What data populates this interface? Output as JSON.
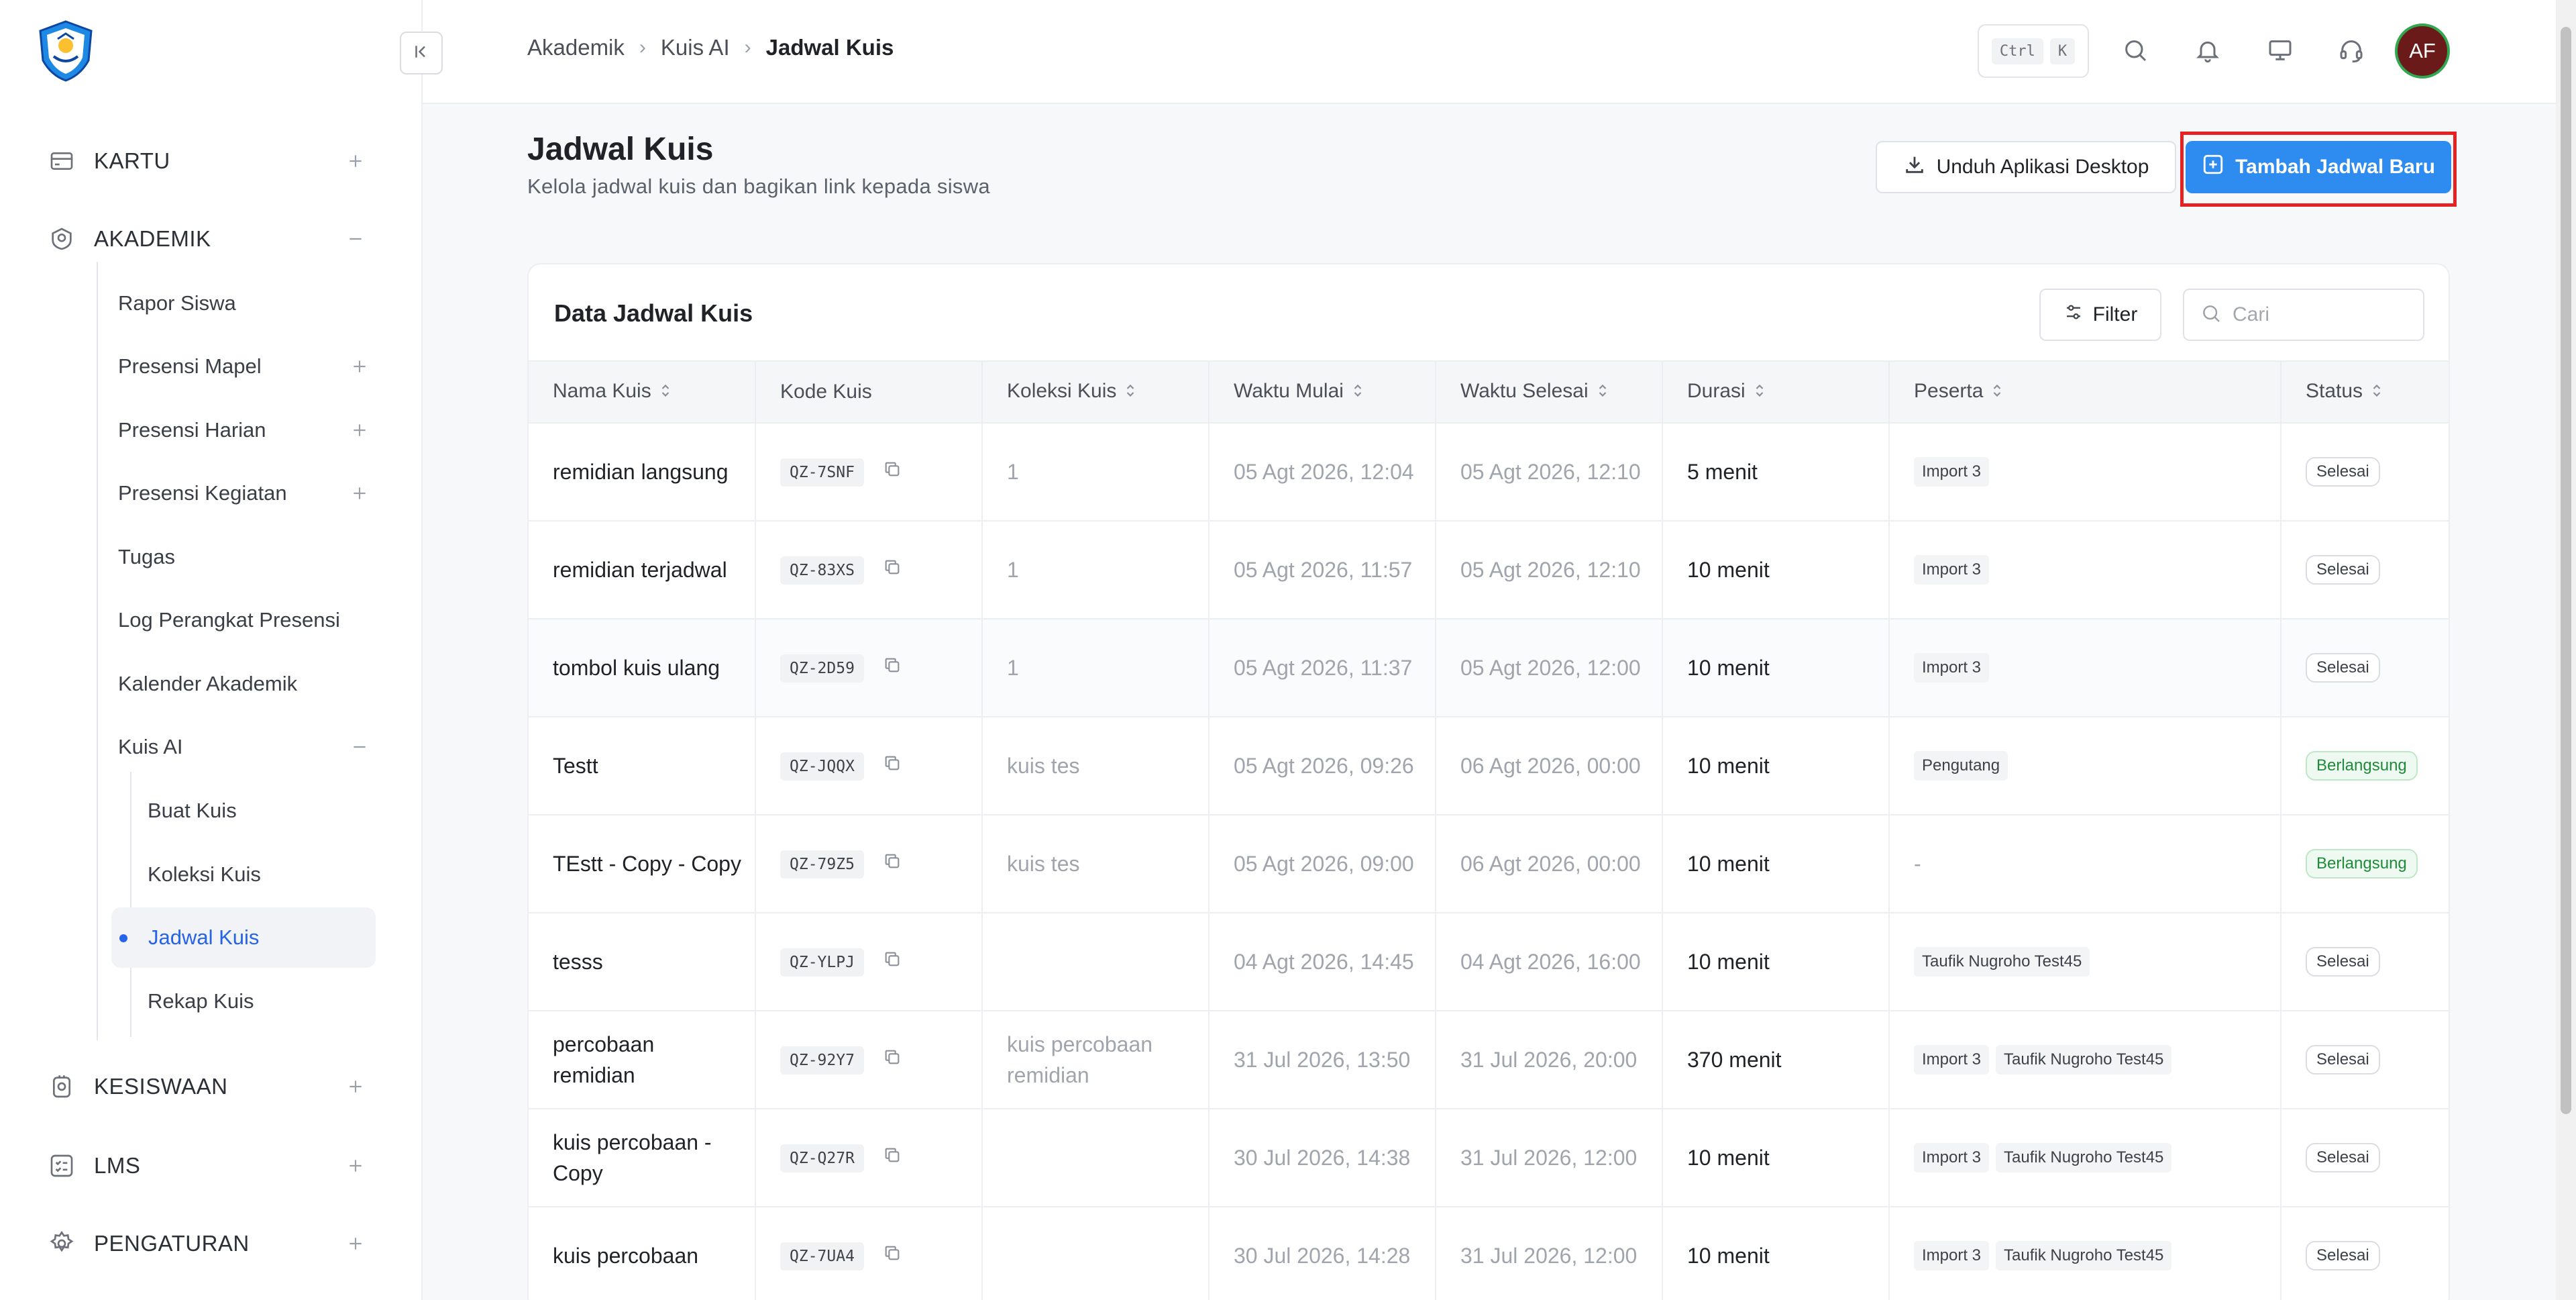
{
  "sidebar": {
    "groups": {
      "kartu": "KARTU",
      "akademik": "AKADEMIK",
      "kesiswaan": "KESISWAAN",
      "lms": "LMS",
      "pengaturan": "PENGATURAN"
    },
    "akademik_items": [
      "Rapor Siswa",
      "Presensi Mapel",
      "Presensi Harian",
      "Presensi Kegiatan",
      "Tugas",
      "Log Perangkat Presensi",
      "Kalender Akademik",
      "Kuis AI"
    ],
    "kuis_ai_items": [
      "Buat Kuis",
      "Koleksi Kuis",
      "Jadwal Kuis",
      "Rekap Kuis"
    ]
  },
  "header": {
    "breadcrumb": [
      "Akademik",
      "Kuis AI",
      "Jadwal Kuis"
    ],
    "shortcut": [
      "Ctrl",
      "K"
    ],
    "avatar_initials": "AF"
  },
  "page": {
    "title": "Jadwal Kuis",
    "subtitle": "Kelola jadwal kuis dan bagikan link kepada siswa",
    "download_button": "Unduh Aplikasi Desktop",
    "add_button": "Tambah Jadwal Baru"
  },
  "table_card": {
    "title": "Data Jadwal Kuis",
    "filter_label": "Filter",
    "search_placeholder": "Cari",
    "columns": [
      "Nama Kuis",
      "Kode Kuis",
      "Koleksi Kuis",
      "Waktu Mulai",
      "Waktu Selesai",
      "Durasi",
      "Peserta",
      "Status"
    ],
    "rows": [
      {
        "name": "remidian langsung",
        "code": "QZ-7SNF",
        "collection": "1",
        "start": "05 Agt 2026, 12:04",
        "end": "05 Agt 2026, 12:10",
        "duration": "5 menit",
        "participants": [
          "Import 3"
        ],
        "status": "Selesai"
      },
      {
        "name": "remidian terjadwal",
        "code": "QZ-83XS",
        "collection": "1",
        "start": "05 Agt 2026, 11:57",
        "end": "05 Agt 2026, 12:10",
        "duration": "10 menit",
        "participants": [
          "Import 3"
        ],
        "status": "Selesai"
      },
      {
        "name": "tombol kuis ulang",
        "code": "QZ-2D59",
        "collection": "1",
        "start": "05 Agt 2026, 11:37",
        "end": "05 Agt 2026, 12:00",
        "duration": "10 menit",
        "participants": [
          "Import 3"
        ],
        "status": "Selesai"
      },
      {
        "name": "Testt",
        "code": "QZ-JQQX",
        "collection": "kuis tes",
        "start": "05 Agt 2026, 09:26",
        "end": "06 Agt 2026, 00:00",
        "duration": "10 menit",
        "participants": [
          "Pengutang"
        ],
        "status": "Berlangsung"
      },
      {
        "name": "TEstt - Copy - Copy",
        "code": "QZ-79Z5",
        "collection": "kuis tes",
        "start": "05 Agt 2026, 09:00",
        "end": "06 Agt 2026, 00:00",
        "duration": "10 menit",
        "participants_text": "-",
        "status": "Berlangsung"
      },
      {
        "name": "tesss",
        "code": "QZ-YLPJ",
        "collection": "",
        "start": "04 Agt 2026, 14:45",
        "end": "04 Agt 2026, 16:00",
        "duration": "10 menit",
        "participants": [
          "Taufik Nugroho Test45"
        ],
        "status": "Selesai"
      },
      {
        "name": "percobaan remidian",
        "code": "QZ-92Y7",
        "collection": "kuis percobaan remidian",
        "start": "31 Jul 2026, 13:50",
        "end": "31 Jul 2026, 20:00",
        "duration": "370 menit",
        "participants": [
          "Import 3",
          "Taufik Nugroho Test45"
        ],
        "status": "Selesai"
      },
      {
        "name": "kuis percobaan - Copy",
        "code": "QZ-Q27R",
        "collection": "",
        "start": "30 Jul 2026, 14:38",
        "end": "31 Jul 2026, 12:00",
        "duration": "10 menit",
        "participants": [
          "Import 3",
          "Taufik Nugroho Test45"
        ],
        "status": "Selesai"
      },
      {
        "name": "kuis percobaan",
        "code": "QZ-7UA4",
        "collection": "",
        "start": "30 Jul 2026, 14:28",
        "end": "31 Jul 2026, 12:00",
        "duration": "10 menit",
        "participants": [
          "Import 3",
          "Taufik Nugroho Test45"
        ],
        "status": "Selesai"
      }
    ]
  },
  "colors": {
    "primary": "#2e8bf0",
    "active_nav": "#2563eb",
    "highlight_frame": "#e52222",
    "status_live": "#1f8a3a",
    "avatar_bg": "#6b1a1a",
    "avatar_ring": "#2fa84f"
  }
}
